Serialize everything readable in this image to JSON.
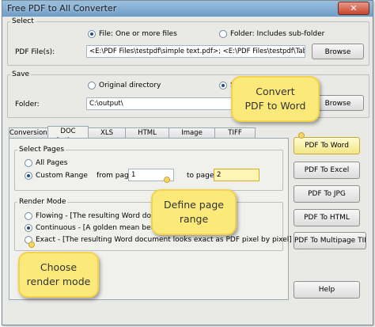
{
  "window": {
    "title": "Free PDF to All Converter",
    "close_glyph": "✕"
  },
  "select": {
    "group_label": "Select",
    "option_file": "File:  One or more files",
    "option_folder": "Folder: Includes sub-folder",
    "pdf_files_label": "PDF File(s):",
    "pdf_files_value": "<E:\\PDF Files\\testpdf\\simple text.pdf>; <E:\\PDF Files\\testpdf\\Table.pdf>; <E:\\PDF",
    "browse_label": "Browse"
  },
  "save": {
    "group_label": "Save",
    "option_original": "Original directory",
    "option_select_partial": "Se",
    "folder_label": "Folder:",
    "folder_value": "C:\\output\\",
    "browse_label": "Browse"
  },
  "tabs": [
    "Conversions",
    "DOC Options",
    "XLS Options",
    "HTML Options",
    "Image Options",
    "TIFF Options"
  ],
  "active_tab": "DOC Options",
  "doc_options": {
    "select_pages": {
      "group_label": "Select Pages",
      "option_all": "All Pages",
      "option_custom": "Custom Range",
      "from_label": "from page:",
      "from_value": "1",
      "to_label": "to page:",
      "to_value": "2"
    },
    "render_mode": {
      "group_label": "Render Mode",
      "option_flowing": "Flowing - [The resulting Word document lo",
      "option_continuous": "Continuous - [A golden mean between Flow",
      "option_exact": "Exact - [The resulting Word document looks exact as PDF pixel by pixel]"
    }
  },
  "actions": {
    "pdf_to_word": "PDF To Word",
    "pdf_to_excel": "PDF To Excel",
    "pdf_to_jpg": "PDF To JPG",
    "pdf_to_html": "PDF To HTML",
    "pdf_to_multipage_tiff": "PDF To Multipage TIFF",
    "help": "Help"
  },
  "callouts": {
    "convert": "Convert\nPDF to Word",
    "define_range": "Define page\nrange",
    "render_mode": "Choose\nrender mode"
  },
  "colors": {
    "callout_fill": "#fbe97a",
    "highlight_field": "#fff6b5",
    "primary_button": "#f3e785"
  }
}
